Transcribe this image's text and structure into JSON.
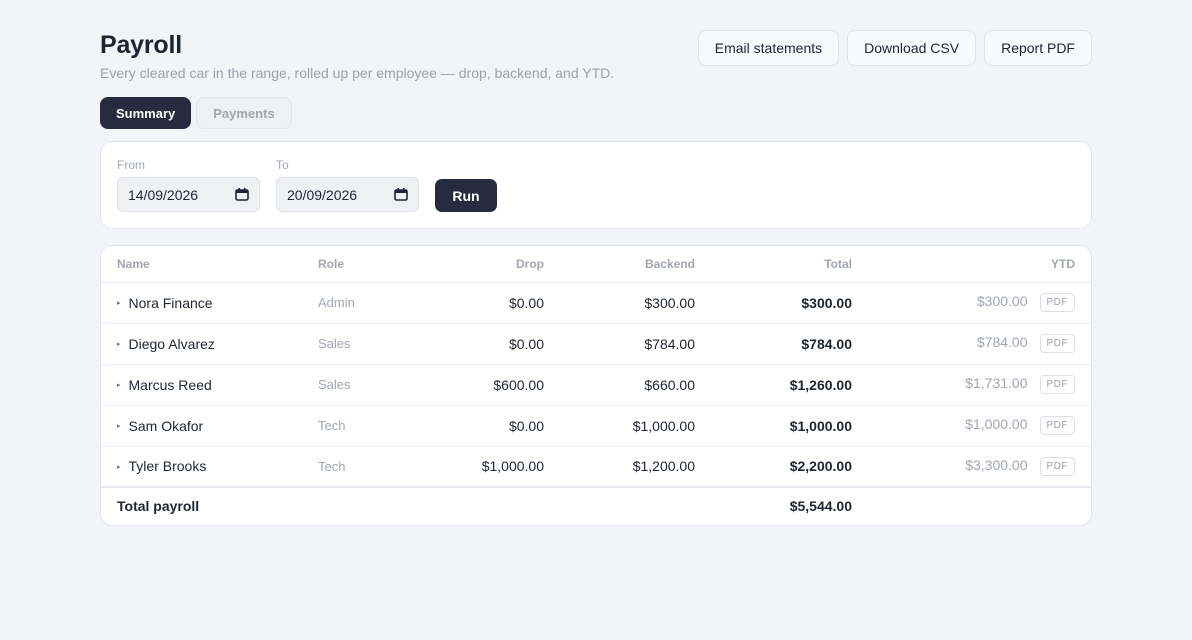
{
  "header": {
    "title": "Payroll",
    "subtitle": "Every cleared car in the range, rolled up per employee — drop, backend, and YTD."
  },
  "actions": {
    "email": "Email statements",
    "csv": "Download CSV",
    "pdf": "Report PDF"
  },
  "tabs": [
    {
      "label": "Summary",
      "active": true
    },
    {
      "label": "Payments",
      "active": false
    }
  ],
  "filters": {
    "from_label": "From",
    "from_value": "14/09/2026",
    "to_label": "To",
    "to_value": "20/09/2026",
    "run_label": "Run"
  },
  "table": {
    "columns": [
      "Name",
      "Role",
      "Drop",
      "Backend",
      "Total",
      "YTD"
    ],
    "pdf_label": "PDF",
    "rows": [
      {
        "name": "Nora Finance",
        "role": "Admin",
        "drop": "$0.00",
        "backend": "$300.00",
        "total": "$300.00",
        "ytd": "$300.00"
      },
      {
        "name": "Diego Alvarez",
        "role": "Sales",
        "drop": "$0.00",
        "backend": "$784.00",
        "total": "$784.00",
        "ytd": "$784.00"
      },
      {
        "name": "Marcus Reed",
        "role": "Sales",
        "drop": "$600.00",
        "backend": "$660.00",
        "total": "$1,260.00",
        "ytd": "$1,731.00"
      },
      {
        "name": "Sam Okafor",
        "role": "Tech",
        "drop": "$0.00",
        "backend": "$1,000.00",
        "total": "$1,000.00",
        "ytd": "$1,000.00"
      },
      {
        "name": "Tyler Brooks",
        "role": "Tech",
        "drop": "$1,000.00",
        "backend": "$1,200.00",
        "total": "$2,200.00",
        "ytd": "$3,300.00"
      }
    ],
    "total_label": "Total payroll",
    "total_value": "$5,544.00"
  },
  "colors": {
    "accent": "#262b40",
    "background": "#f3f4f8",
    "muted": "#a1a6b1"
  },
  "icons": {
    "row_expand": "caret-right-icon",
    "date_picker": "calendar-icon"
  }
}
